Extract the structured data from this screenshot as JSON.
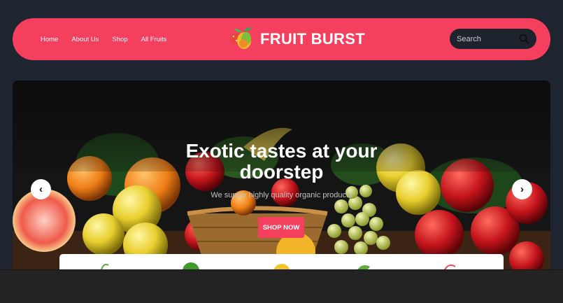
{
  "nav": {
    "items": [
      {
        "label": "Home"
      },
      {
        "label": "About Us"
      },
      {
        "label": "Shop"
      },
      {
        "label": "All Fruits"
      }
    ]
  },
  "brand": {
    "name": "FRUIT BURST",
    "logo_icon": "fruit-logo-icon"
  },
  "search": {
    "placeholder": "Search",
    "icon": "search-icon"
  },
  "hero": {
    "title_line1": "Exotic tastes at your",
    "title_line2": "doorstep",
    "subtitle": "We supply highly quality organic products",
    "cta_label": "SHOP NOW",
    "prev_icon": "chevron-left-icon",
    "next_icon": "chevron-right-icon",
    "prev_glyph": "‹",
    "next_glyph": "›"
  },
  "colors": {
    "accent": "#f43f5e",
    "background": "#1f2530",
    "search_bg": "#1d232c"
  }
}
